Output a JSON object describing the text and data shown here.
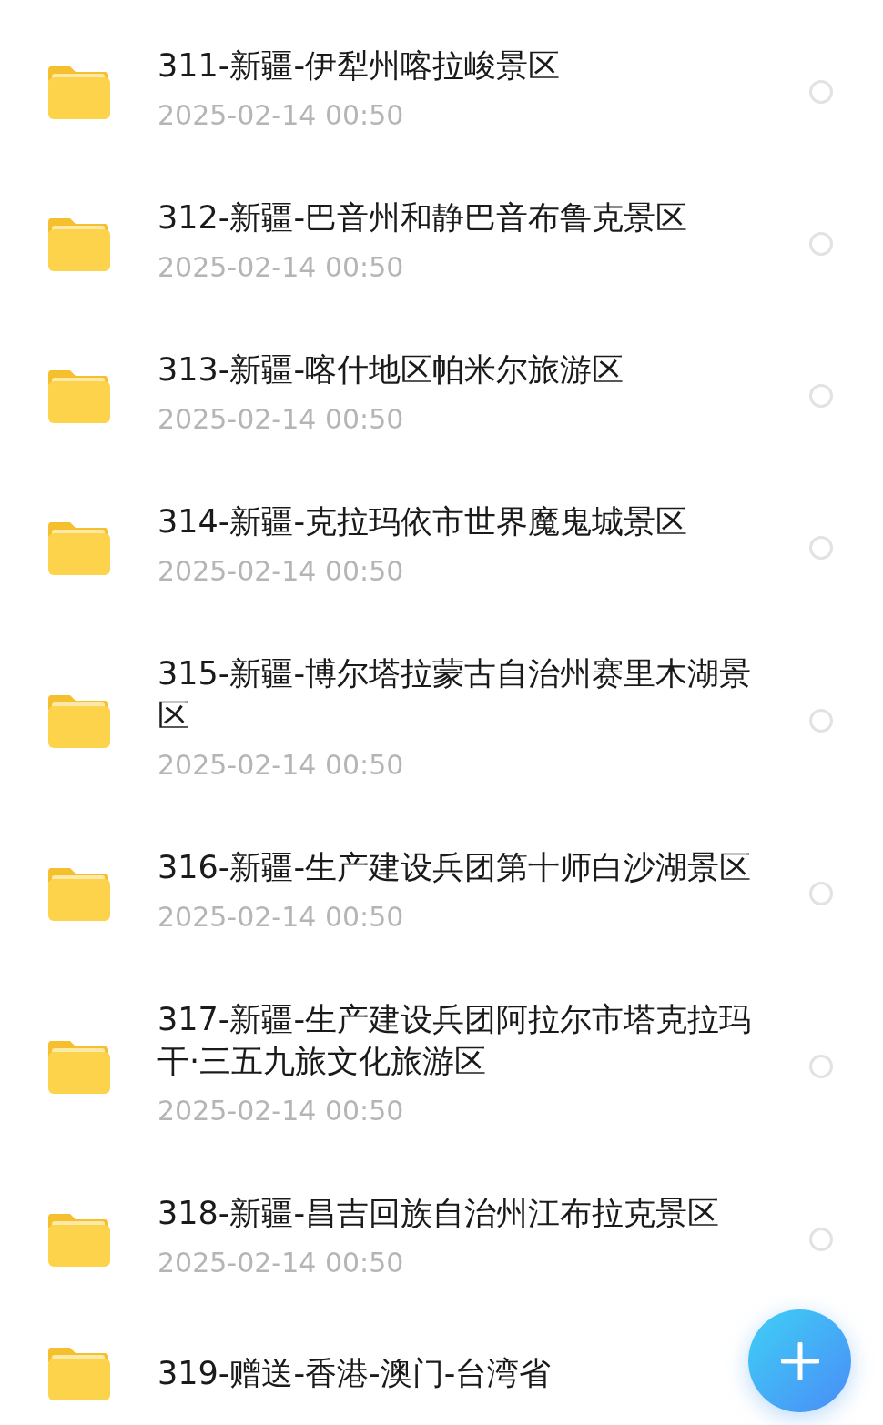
{
  "files": [
    {
      "name": "311-新疆-伊犁州喀拉峻景区",
      "date": "2025-02-14  00:50",
      "selected": false
    },
    {
      "name": "312-新疆-巴音州和静巴音布鲁克景区",
      "date": "2025-02-14  00:50",
      "selected": false
    },
    {
      "name": "313-新疆-喀什地区帕米尔旅游区",
      "date": "2025-02-14  00:50",
      "selected": false
    },
    {
      "name": "314-新疆-克拉玛依市世界魔鬼城景区",
      "date": "2025-02-14  00:50",
      "selected": false
    },
    {
      "name": "315-新疆-博尔塔拉蒙古自治州赛里木湖景区",
      "date": "2025-02-14  00:50",
      "selected": false
    },
    {
      "name": "316-新疆-生产建设兵团第十师白沙湖景区",
      "date": "2025-02-14  00:50",
      "selected": false
    },
    {
      "name": "317-新疆-生产建设兵团阿拉尔市塔克拉玛干·三五九旅文化旅游区",
      "date": "2025-02-14  00:50",
      "selected": false
    },
    {
      "name": "318-新疆-昌吉回族自治州江布拉克景区",
      "date": "2025-02-14  00:50",
      "selected": false
    },
    {
      "name": "319-赠送-香港-澳门-台湾省"
    }
  ]
}
